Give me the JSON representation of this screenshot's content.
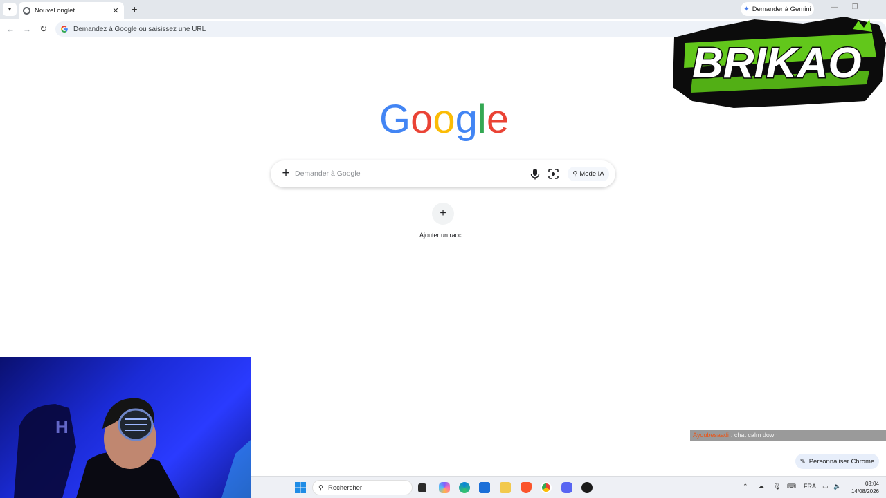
{
  "tab_strip": {
    "tab_title": "Nouvel onglet",
    "gemini_label": "Demander à Gemini"
  },
  "toolbar": {
    "omnibox_placeholder": "Demandez à Google ou saisissez une URL"
  },
  "content": {
    "logo_text": "Google",
    "search_placeholder": "Demander à Google",
    "mode_ia_label": "Mode IA",
    "shortcut_label": "Ajouter un racc..."
  },
  "overlay": {
    "brand_text": "BRIKAO",
    "chat_user": "Ayoubesaadi",
    "chat_message": ": chat calm down",
    "customize_label": "Personnaliser Chrome"
  },
  "taskbar": {
    "search_label": "Rechercher",
    "language": "FRA",
    "time": "03:04",
    "date": "14/08/2026"
  },
  "colors": {
    "google_blue": "#4285f4",
    "google_red": "#ea4335",
    "google_yellow": "#fbbc05",
    "google_green": "#34a853",
    "brand_green": "#6bdc1d"
  }
}
